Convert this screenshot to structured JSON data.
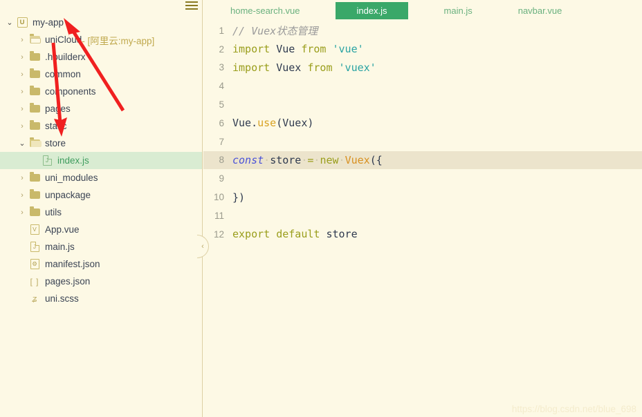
{
  "sidebar": {
    "menu_icon": "hamburger-icon",
    "collapse_icon": "‹",
    "tree": [
      {
        "depth": 0,
        "twisty": "⌄",
        "twisty_open": true,
        "icon": "uniapp-logo-icon",
        "icon_glyph": "U",
        "label": "my-app",
        "sub": "",
        "selected": false
      },
      {
        "depth": 1,
        "twisty": "›",
        "twisty_open": false,
        "icon": "folder-open-light-icon",
        "icon_glyph": "",
        "label": "uniCloud",
        "sub": " - [阿里云:my-app]",
        "selected": false
      },
      {
        "depth": 1,
        "twisty": "›",
        "twisty_open": false,
        "icon": "folder-icon",
        "icon_glyph": "",
        "label": ".hbuilderx",
        "sub": "",
        "selected": false
      },
      {
        "depth": 1,
        "twisty": "›",
        "twisty_open": false,
        "icon": "folder-icon",
        "icon_glyph": "",
        "label": "common",
        "sub": "",
        "selected": false
      },
      {
        "depth": 1,
        "twisty": "›",
        "twisty_open": false,
        "icon": "folder-icon",
        "icon_glyph": "",
        "label": "components",
        "sub": "",
        "selected": false
      },
      {
        "depth": 1,
        "twisty": "›",
        "twisty_open": false,
        "icon": "folder-icon",
        "icon_glyph": "",
        "label": "pages",
        "sub": "",
        "selected": false
      },
      {
        "depth": 1,
        "twisty": "›",
        "twisty_open": false,
        "icon": "folder-icon",
        "icon_glyph": "",
        "label": "static",
        "sub": "",
        "selected": false
      },
      {
        "depth": 1,
        "twisty": "⌄",
        "twisty_open": true,
        "icon": "folder-open-icon",
        "icon_glyph": "",
        "label": "store",
        "sub": "",
        "selected": false
      },
      {
        "depth": 2,
        "twisty": "",
        "twisty_open": false,
        "icon": "js-file-icon",
        "icon_glyph": "J",
        "label": "index.js",
        "sub": "",
        "selected": true
      },
      {
        "depth": 1,
        "twisty": "›",
        "twisty_open": false,
        "icon": "folder-icon",
        "icon_glyph": "",
        "label": "uni_modules",
        "sub": "",
        "selected": false
      },
      {
        "depth": 1,
        "twisty": "›",
        "twisty_open": false,
        "icon": "folder-icon",
        "icon_glyph": "",
        "label": "unpackage",
        "sub": "",
        "selected": false
      },
      {
        "depth": 1,
        "twisty": "›",
        "twisty_open": false,
        "icon": "folder-icon",
        "icon_glyph": "",
        "label": "utils",
        "sub": "",
        "selected": false
      },
      {
        "depth": 1,
        "twisty": "",
        "twisty_open": false,
        "icon": "vue-file-icon",
        "icon_glyph": "V",
        "label": "App.vue",
        "sub": "",
        "selected": false
      },
      {
        "depth": 1,
        "twisty": "",
        "twisty_open": false,
        "icon": "js-file-icon",
        "icon_glyph": "J",
        "label": "main.js",
        "sub": "",
        "selected": false
      },
      {
        "depth": 1,
        "twisty": "",
        "twisty_open": false,
        "icon": "manifest-gear-icon",
        "icon_glyph": "⚙",
        "label": "manifest.json",
        "sub": "",
        "selected": false
      },
      {
        "depth": 1,
        "twisty": "",
        "twisty_open": false,
        "icon": "json-brackets-icon",
        "icon_glyph": "[ ]",
        "label": "pages.json",
        "sub": "",
        "selected": false
      },
      {
        "depth": 1,
        "twisty": "",
        "twisty_open": false,
        "icon": "scss-file-icon",
        "icon_glyph": "ʑ",
        "label": "uni.scss",
        "sub": "",
        "selected": false
      }
    ]
  },
  "tabs": [
    {
      "label": "home-search.vue",
      "active": false
    },
    {
      "label": "index.js",
      "active": true
    },
    {
      "label": "main.js",
      "active": false
    },
    {
      "label": "navbar.vue",
      "active": false
    }
  ],
  "editor": {
    "lines": [
      {
        "num": "1",
        "highlight": false,
        "tokens": [
          {
            "t": "// Vuex状态管理",
            "c": "t-comment"
          }
        ]
      },
      {
        "num": "2",
        "highlight": false,
        "tokens": [
          {
            "t": "import",
            "c": "t-kw"
          },
          {
            "t": " ",
            "c": ""
          },
          {
            "t": "Vue",
            "c": "t-ident"
          },
          {
            "t": " ",
            "c": ""
          },
          {
            "t": "from",
            "c": "t-kw"
          },
          {
            "t": " ",
            "c": ""
          },
          {
            "t": "'vue'",
            "c": "t-str"
          }
        ]
      },
      {
        "num": "3",
        "highlight": false,
        "tokens": [
          {
            "t": "import",
            "c": "t-kw"
          },
          {
            "t": " ",
            "c": ""
          },
          {
            "t": "Vuex",
            "c": "t-ident"
          },
          {
            "t": " ",
            "c": ""
          },
          {
            "t": "from",
            "c": "t-kw"
          },
          {
            "t": " ",
            "c": ""
          },
          {
            "t": "'vuex'",
            "c": "t-str"
          }
        ]
      },
      {
        "num": "4",
        "highlight": false,
        "tokens": []
      },
      {
        "num": "5",
        "highlight": false,
        "tokens": []
      },
      {
        "num": "6",
        "highlight": false,
        "tokens": [
          {
            "t": "Vue",
            "c": "t-ident"
          },
          {
            "t": ".",
            "c": "t-punc"
          },
          {
            "t": "use",
            "c": "t-func"
          },
          {
            "t": "(Vuex)",
            "c": "t-ident"
          }
        ]
      },
      {
        "num": "7",
        "highlight": false,
        "tokens": []
      },
      {
        "num": "8",
        "highlight": true,
        "tokens": [
          {
            "t": "const",
            "c": "t-const"
          },
          {
            "t": "·",
            "c": "dot"
          },
          {
            "t": "store",
            "c": "t-ident"
          },
          {
            "t": "·",
            "c": "dot"
          },
          {
            "t": "=",
            "c": "t-op"
          },
          {
            "t": "·",
            "c": "dot"
          },
          {
            "t": "new",
            "c": "t-op"
          },
          {
            "t": "·",
            "c": "dot"
          },
          {
            "t": "Vuex",
            "c": "t-cls"
          },
          {
            "t": "({",
            "c": "t-punc"
          }
        ]
      },
      {
        "num": "9",
        "highlight": false,
        "tokens": []
      },
      {
        "num": "10",
        "highlight": false,
        "tokens": [
          {
            "t": "})",
            "c": "t-punc"
          }
        ]
      },
      {
        "num": "11",
        "highlight": false,
        "tokens": []
      },
      {
        "num": "12",
        "highlight": false,
        "tokens": [
          {
            "t": "export",
            "c": "t-kw"
          },
          {
            "t": " ",
            "c": ""
          },
          {
            "t": "default",
            "c": "t-kw"
          },
          {
            "t": " ",
            "c": ""
          },
          {
            "t": "store",
            "c": "t-ident"
          }
        ]
      }
    ]
  },
  "annotations": {
    "arrow_color": "#f02020",
    "arrow_up_target": "my-app",
    "arrow_down_target": "store"
  },
  "watermark": {
    "text": "https://blog.csdn.net/blue_698"
  },
  "colors": {
    "background": "#fdf9e5",
    "accent_green": "#3aa869",
    "selection_green": "#d9ecd2",
    "folder_gold": "#c9b96a",
    "divider": "#ddd0a4",
    "current_line": "#ece4cc"
  }
}
